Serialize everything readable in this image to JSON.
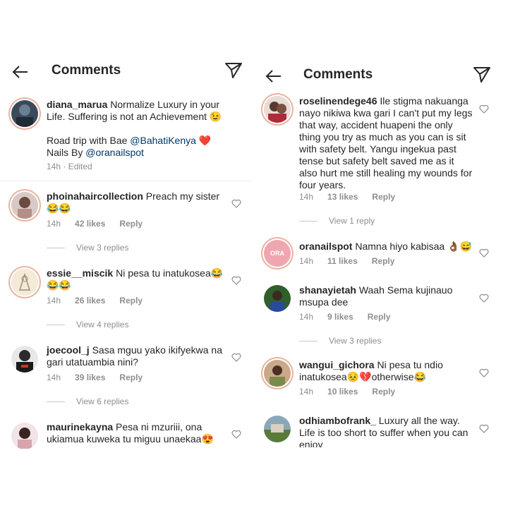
{
  "left": {
    "title": "Comments",
    "caption": {
      "username": "diana_marua",
      "line1": " Normalize Luxury in your",
      "line2": "Life. Suffering is not an Achievement 😉",
      "line3": "Road trip with Bae ",
      "mention1": "@BahatiKenya",
      "heart": " ❤️",
      "line4": "Nails By ",
      "mention2": "@oranailspot",
      "time": "14h · Edited"
    },
    "comments": [
      {
        "username": "phoinahaircollection",
        "text1": " Preach my sister",
        "text2": "😂😂",
        "time": "14h",
        "likes": "42 likes",
        "reply": "Reply",
        "view": "View 3 replies"
      },
      {
        "username": "essie__miscik",
        "text1": " Ni pesa tu inatukosea😂",
        "text2": "😂😂",
        "time": "14h",
        "likes": "26 likes",
        "reply": "Reply",
        "view": "View 4 replies"
      },
      {
        "username": "joecool_j",
        "text1": " Sasa mguu yako ikifyekwa na",
        "text2": "gari utatuambia nini?",
        "time": "14h",
        "likes": "39 likes",
        "reply": "Reply",
        "view": "View 6 replies"
      },
      {
        "username": "maurinekayna",
        "text1": " Pesa ni mzuriii, ona",
        "text2": "ukiamua kuweka tu miguu unaekaa😍"
      }
    ]
  },
  "right": {
    "title": "Comments",
    "comments": [
      {
        "username": "roselinendege46",
        "lines": [
          " Ile stigma nakuanga",
          "nayo nikiwa kwa gari I can't put my legs",
          "that way, accident huapeni the only",
          "thing you  try as much as you can is sit",
          "with safety belt. Yangu ingekua past",
          "tense but safety belt saved me as it",
          "also hurt me still healing my wounds for",
          "four years."
        ],
        "time": "14h",
        "likes": "13 likes",
        "reply": "Reply",
        "view": "View 1 reply"
      },
      {
        "username": "oranailspot",
        "lines": [
          " Namna hiyo kabisaa 👌🏾😅"
        ],
        "time": "14h",
        "likes": "11 likes",
        "reply": "Reply",
        "avatar_text": "ORA"
      },
      {
        "username": "shanayietah",
        "lines": [
          " Waah Sema kujinauo",
          "msupa dee"
        ],
        "time": "14h",
        "likes": "9 likes",
        "reply": "Reply",
        "view": "View 3 replies"
      },
      {
        "username": "wangui_gichora",
        "lines": [
          " Ni pesa tu ndio",
          "inatukosea😣💔otherwise😂"
        ],
        "time": "14h",
        "likes": "10 likes",
        "reply": "Reply"
      },
      {
        "username": "odhiambofrank_",
        "lines": [
          " Luxury all the way.",
          "Life is too short to suffer when you can",
          "enjoy"
        ]
      }
    ]
  },
  "colors": {
    "text": "#262626",
    "muted": "#8e8e8e",
    "mention": "#00376b",
    "ring": "#e9b4a0"
  }
}
